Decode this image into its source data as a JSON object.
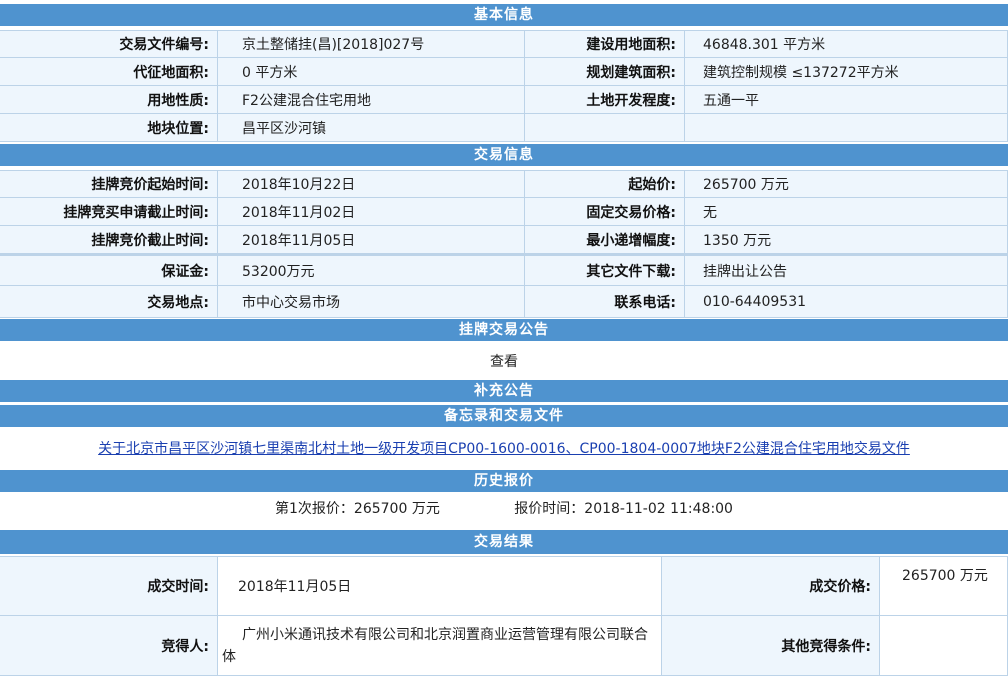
{
  "sections": {
    "basic": "基本信息",
    "trade": "交易信息",
    "listing_notice": "挂牌交易公告",
    "supplement": "补充公告",
    "memo": "备忘录和交易文件",
    "history": "历史报价",
    "result": "交易结果"
  },
  "basic": {
    "file_no_label": "交易文件编号:",
    "file_no": "京土整储挂(昌)[2018]027号",
    "land_area_label": "建设用地面积:",
    "land_area": "46848.301 平方米",
    "levy_area_label": "代征地面积:",
    "levy_area": "0 平方米",
    "build_area_label": "规划建筑面积:",
    "build_area": "建筑控制规模 ≤137272平方米",
    "usage_label": "用地性质:",
    "usage": "F2公建混合住宅用地",
    "dev_label": "土地开发程度:",
    "dev": "五通一平",
    "location_label": "地块位置:",
    "location": "昌平区沙河镇"
  },
  "trade": {
    "start_label": "挂牌竞价起始时间:",
    "start": "2018年10月22日",
    "start_price_label": "起始价:",
    "start_price": "265700 万元",
    "apply_end_label": "挂牌竞买申请截止时间:",
    "apply_end": "2018年11月02日",
    "fixed_price_label": "固定交易价格:",
    "fixed_price": "无",
    "bid_end_label": "挂牌竞价截止时间:",
    "bid_end": "2018年11月05日",
    "min_inc_label": "最小递增幅度:",
    "min_inc": "1350 万元",
    "deposit_label": "保证金:",
    "deposit": "53200万元",
    "other_files_label": "其它文件下载:",
    "other_files": "挂牌出让公告",
    "place_label": "交易地点:",
    "place": "市中心交易市场",
    "phone_label": "联系电话:",
    "phone": "010-64409531"
  },
  "listing_notice_view": "查看",
  "memo_link": "关于北京市昌平区沙河镇七里渠南北村土地一级开发项目CP00-1600-0016、CP00-1804-0007地块F2公建混合住宅用地交易文件",
  "history": {
    "offer": "第1次报价：265700 万元",
    "time": "报价时间：2018-11-02 11:48:00"
  },
  "result": {
    "deal_time_label": "成交时间:",
    "deal_time": "2018年11月05日",
    "deal_price_label": "成交价格:",
    "deal_price": "265700 万元",
    "winner_label": "竞得人:",
    "winner": "广州小米通讯技术有限公司和北京润置商业运营管理有限公司联合体",
    "other_cond_label": "其他竞得条件:",
    "other_cond": ""
  }
}
